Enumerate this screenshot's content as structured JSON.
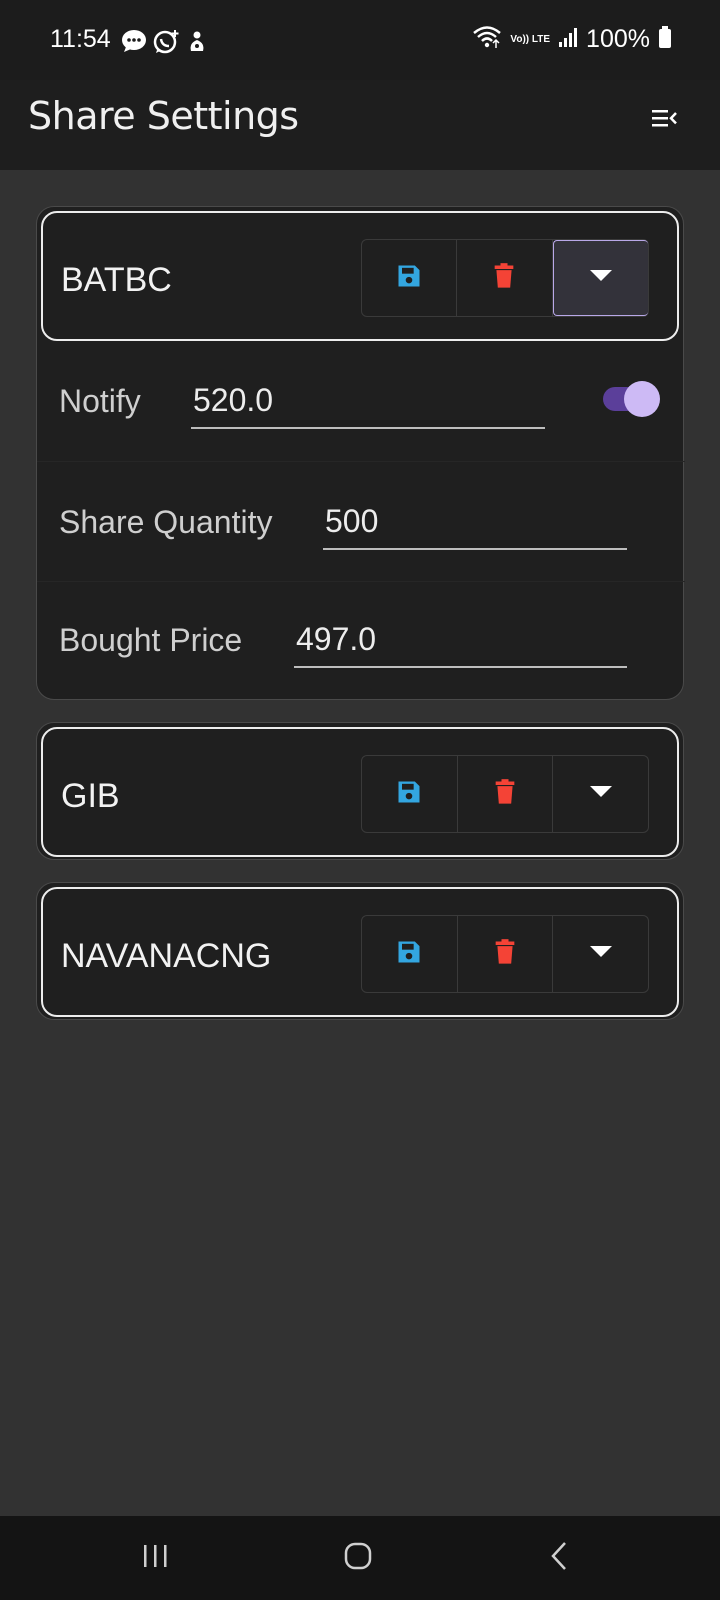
{
  "status_bar": {
    "time": "11:54",
    "battery": "100%",
    "network_label": "Vo)) LTE",
    "notification_icons": [
      "chat-bubble-icon",
      "whatsapp-icon",
      "app-notification-icon"
    ],
    "system_icons": [
      "wifi-icon",
      "volte-icon",
      "signal-icon",
      "battery-icon"
    ]
  },
  "app_bar": {
    "title": "Share Settings",
    "menu_icon": "menu-collapse-icon"
  },
  "colors": {
    "save_icon": "#33a6e0",
    "delete_icon": "#f44336",
    "toggle_accent": "#cdbaf5",
    "background": "#323232",
    "card": "#1f1f1f"
  },
  "shares": [
    {
      "name": "BATBC",
      "expanded": true,
      "notify_label": "Notify",
      "notify_value": "520.0",
      "notify_enabled": true,
      "quantity_label": "Share Quantity",
      "quantity_value": "500",
      "price_label": "Bought Price",
      "price_value": "497.0"
    },
    {
      "name": "GIB",
      "expanded": false
    },
    {
      "name": "NAVANACNG",
      "expanded": false
    }
  ],
  "nav_bar": {
    "items": [
      "recent-apps-icon",
      "home-icon",
      "back-icon"
    ]
  }
}
